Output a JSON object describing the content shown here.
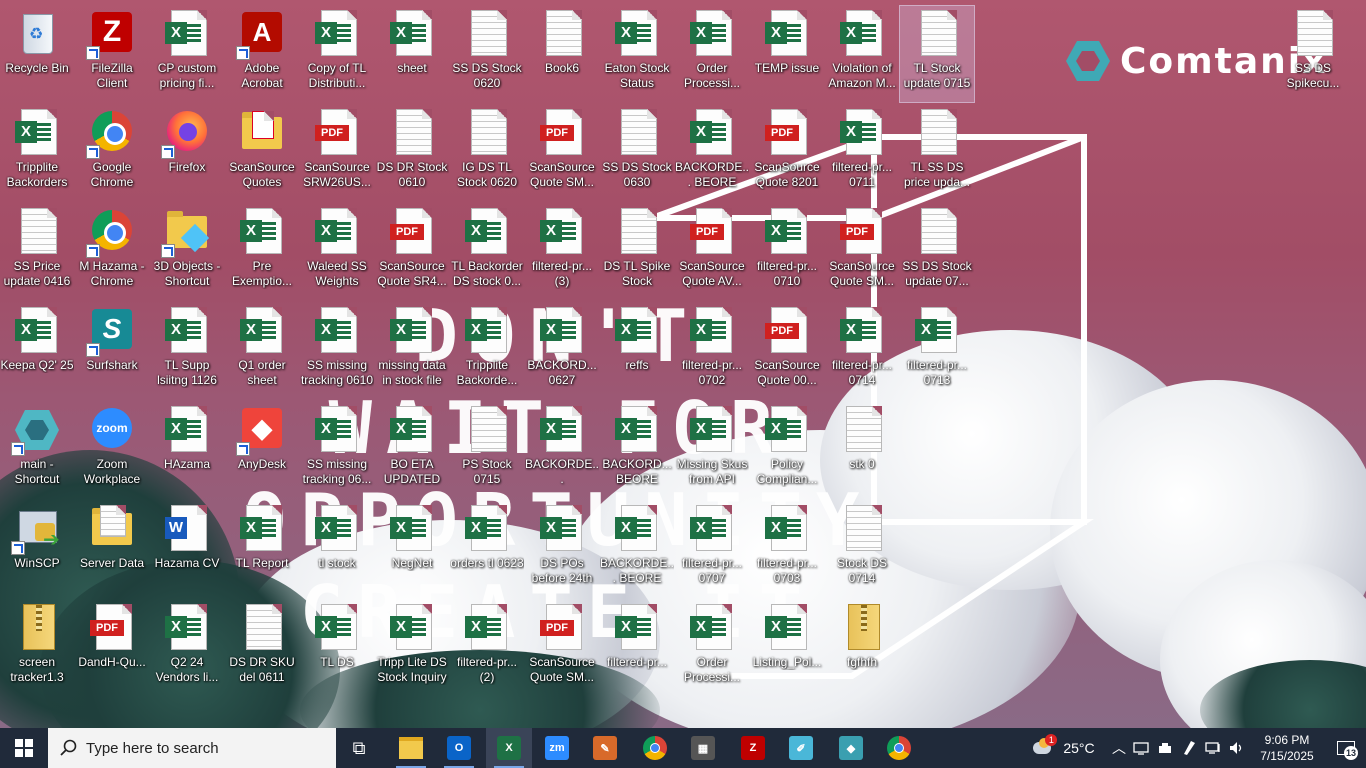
{
  "brand": {
    "name": "Comtanix"
  },
  "motto": {
    "lines": [
      "DON'T",
      "WAIT FOR",
      "OPPORTUNITY",
      "CREATE IT"
    ]
  },
  "desktop_icons": [
    {
      "label": "Recycle Bin",
      "kind": "recycle",
      "col": 0,
      "row": 0
    },
    {
      "label": "FileZilla Client",
      "kind": "filezilla",
      "col": 1,
      "row": 0,
      "shortcut": true
    },
    {
      "label": "CP custom pricing fi...",
      "kind": "excel",
      "col": 2,
      "row": 0
    },
    {
      "label": "Adobe Acrobat",
      "kind": "acrobat",
      "col": 3,
      "row": 0,
      "shortcut": true
    },
    {
      "label": "Copy of TL Distributi...",
      "kind": "excel",
      "col": 4,
      "row": 0
    },
    {
      "label": "sheet",
      "kind": "excel",
      "col": 5,
      "row": 0
    },
    {
      "label": "SS DS Stock 0620",
      "kind": "text",
      "col": 6,
      "row": 0
    },
    {
      "label": "Book6",
      "kind": "text",
      "col": 7,
      "row": 0
    },
    {
      "label": "Eaton Stock Status",
      "kind": "excel",
      "col": 8,
      "row": 0
    },
    {
      "label": "Order Processi...",
      "kind": "excel",
      "col": 9,
      "row": 0
    },
    {
      "label": "TEMP issue",
      "kind": "excel",
      "col": 10,
      "row": 0
    },
    {
      "label": "Violation of Amazon M...",
      "kind": "excel",
      "col": 11,
      "row": 0
    },
    {
      "label": "TL Stock update 0715",
      "kind": "text",
      "col": 12,
      "row": 0,
      "selected": true
    },
    {
      "label": "Tripplite Backorders",
      "kind": "excel",
      "col": 0,
      "row": 1
    },
    {
      "label": "Google Chrome",
      "kind": "chrome",
      "col": 1,
      "row": 1,
      "shortcut": true
    },
    {
      "label": "Firefox",
      "kind": "firefox",
      "col": 2,
      "row": 1,
      "shortcut": true
    },
    {
      "label": "ScanSource Quotes",
      "kind": "folder",
      "col": 3,
      "row": 1
    },
    {
      "label": "ScanSource SRW26US...",
      "kind": "pdf",
      "col": 4,
      "row": 1
    },
    {
      "label": "DS DR Stock 0610",
      "kind": "text",
      "col": 5,
      "row": 1
    },
    {
      "label": "IG DS TL Stock 0620",
      "kind": "text",
      "col": 6,
      "row": 1
    },
    {
      "label": "ScanSource Quote SM...",
      "kind": "pdf",
      "col": 7,
      "row": 1
    },
    {
      "label": "SS DS Stock 0630",
      "kind": "text",
      "col": 8,
      "row": 1
    },
    {
      "label": "BACKORDE... BEORE 23R...",
      "kind": "excel",
      "col": 9,
      "row": 1
    },
    {
      "label": "ScanSource Quote 8201",
      "kind": "pdf",
      "col": 10,
      "row": 1
    },
    {
      "label": "filtered-pr... 0711",
      "kind": "excel",
      "col": 11,
      "row": 1
    },
    {
      "label": "TL SS DS price upda...",
      "kind": "text",
      "col": 12,
      "row": 1
    },
    {
      "label": "SS Price update 0416",
      "kind": "text",
      "col": 0,
      "row": 2
    },
    {
      "label": "M Hazama - Chrome",
      "kind": "chrome",
      "col": 1,
      "row": 2,
      "shortcut": true
    },
    {
      "label": "3D Objects - Shortcut",
      "kind": "folder3d",
      "col": 2,
      "row": 2,
      "shortcut": true
    },
    {
      "label": "Pre Exemptio...",
      "kind": "excel",
      "col": 3,
      "row": 2
    },
    {
      "label": "Waleed SS Weights",
      "kind": "excel",
      "col": 4,
      "row": 2
    },
    {
      "label": "ScanSource Quote SR4...",
      "kind": "pdf",
      "col": 5,
      "row": 2
    },
    {
      "label": "TL Backorder DS stock 0...",
      "kind": "excel",
      "col": 6,
      "row": 2
    },
    {
      "label": "filtered-pr... (3)",
      "kind": "excel",
      "col": 7,
      "row": 2
    },
    {
      "label": "DS TL Spike Stock",
      "kind": "text",
      "col": 8,
      "row": 2
    },
    {
      "label": "ScanSource Quote AV...",
      "kind": "pdf",
      "col": 9,
      "row": 2
    },
    {
      "label": "filtered-pr... 0710",
      "kind": "excel",
      "col": 10,
      "row": 2
    },
    {
      "label": "ScanSource Quote SM...",
      "kind": "pdf",
      "col": 11,
      "row": 2
    },
    {
      "label": "SS DS Stock update 07...",
      "kind": "text",
      "col": 12,
      "row": 2
    },
    {
      "label": "Keepa Q2' 25",
      "kind": "excel",
      "col": 0,
      "row": 3
    },
    {
      "label": "Surfshark",
      "kind": "surfshark",
      "col": 1,
      "row": 3,
      "shortcut": true
    },
    {
      "label": "TL Supp lsiitng 1126",
      "kind": "excel",
      "col": 2,
      "row": 3
    },
    {
      "label": "Q1 order sheet",
      "kind": "excel",
      "col": 3,
      "row": 3
    },
    {
      "label": "SS missing tracking 0610",
      "kind": "excel",
      "col": 4,
      "row": 3
    },
    {
      "label": "missing data in stock file",
      "kind": "excel",
      "col": 5,
      "row": 3
    },
    {
      "label": "Tripplite Backorde...",
      "kind": "excel",
      "col": 6,
      "row": 3
    },
    {
      "label": "BACKORD... 0627",
      "kind": "excel",
      "col": 7,
      "row": 3
    },
    {
      "label": "reffs",
      "kind": "excel",
      "col": 8,
      "row": 3
    },
    {
      "label": "filtered-pr... 0702",
      "kind": "excel",
      "col": 9,
      "row": 3
    },
    {
      "label": "ScanSource Quote 00...",
      "kind": "pdf",
      "col": 10,
      "row": 3
    },
    {
      "label": "filtered-pr... 0714",
      "kind": "excel",
      "col": 11,
      "row": 3
    },
    {
      "label": "filtered-pr... 0713",
      "kind": "excel",
      "col": 12,
      "row": 3
    },
    {
      "label": "main - Shortcut",
      "kind": "comtanix",
      "col": 0,
      "row": 4,
      "shortcut": true
    },
    {
      "label": "Zoom Workplace",
      "kind": "zoom",
      "col": 1,
      "row": 4
    },
    {
      "label": "HAzama",
      "kind": "excel",
      "col": 2,
      "row": 4
    },
    {
      "label": "AnyDesk",
      "kind": "anydesk",
      "col": 3,
      "row": 4,
      "shortcut": true
    },
    {
      "label": "SS missing tracking 06...",
      "kind": "excel",
      "col": 4,
      "row": 4
    },
    {
      "label": "BO ETA UPDATED",
      "kind": "excel",
      "col": 5,
      "row": 4
    },
    {
      "label": "PS Stock 0715",
      "kind": "text",
      "col": 6,
      "row": 4
    },
    {
      "label": "BACKORDE... 0627(20250...",
      "kind": "excel",
      "col": 7,
      "row": 4
    },
    {
      "label": "BACKORD... BEORE 23R...",
      "kind": "excel",
      "col": 8,
      "row": 4
    },
    {
      "label": "Missing Skus from API",
      "kind": "excel",
      "col": 9,
      "row": 4
    },
    {
      "label": "Policy Complian...",
      "kind": "excel",
      "col": 10,
      "row": 4
    },
    {
      "label": "stk 0",
      "kind": "text",
      "col": 11,
      "row": 4
    },
    {
      "label": "WinSCP",
      "kind": "winscp",
      "col": 0,
      "row": 5,
      "shortcut": true
    },
    {
      "label": "Server Data",
      "kind": "folderdocs",
      "col": 1,
      "row": 5
    },
    {
      "label": "Hazama CV",
      "kind": "word",
      "col": 2,
      "row": 5
    },
    {
      "label": "TL Report",
      "kind": "excel",
      "col": 3,
      "row": 5
    },
    {
      "label": "tl stock",
      "kind": "excel",
      "col": 4,
      "row": 5
    },
    {
      "label": "NegNet",
      "kind": "excel",
      "col": 5,
      "row": 5
    },
    {
      "label": "orders tl 0623",
      "kind": "excel",
      "col": 6,
      "row": 5
    },
    {
      "label": "DS POs before 24th",
      "kind": "excel",
      "col": 7,
      "row": 5
    },
    {
      "label": "BACKORDE... BEORE 23R...",
      "kind": "excel",
      "col": 8,
      "row": 5
    },
    {
      "label": "filtered-pr... 0707",
      "kind": "excel",
      "col": 9,
      "row": 5
    },
    {
      "label": "filtered-pr... 0703",
      "kind": "excel",
      "col": 10,
      "row": 5
    },
    {
      "label": "Stock DS 0714",
      "kind": "text",
      "col": 11,
      "row": 5
    },
    {
      "label": "screen tracker1.3",
      "kind": "zip",
      "col": 0,
      "row": 6
    },
    {
      "label": "DandH-Qu...",
      "kind": "pdf",
      "col": 1,
      "row": 6
    },
    {
      "label": "Q2 24 Vendors li...",
      "kind": "excel",
      "col": 2,
      "row": 6
    },
    {
      "label": "DS DR SKU del 0611",
      "kind": "text",
      "col": 3,
      "row": 6
    },
    {
      "label": "TL DS",
      "kind": "excel",
      "col": 4,
      "row": 6
    },
    {
      "label": "Tripp Lite DS Stock Inquiry",
      "kind": "excel",
      "col": 5,
      "row": 6
    },
    {
      "label": "filtered-pr... (2)",
      "kind": "excel",
      "col": 6,
      "row": 6
    },
    {
      "label": "ScanSource Quote SM...",
      "kind": "pdf",
      "col": 7,
      "row": 6
    },
    {
      "label": "filtered-pr...",
      "kind": "excel",
      "col": 8,
      "row": 6
    },
    {
      "label": "Order Processi...",
      "kind": "excel",
      "col": 9,
      "row": 6
    },
    {
      "label": "Listing_Pol...",
      "kind": "excel",
      "col": 10,
      "row": 6
    },
    {
      "label": "fgfhfh",
      "kind": "zip",
      "col": 11,
      "row": 6
    }
  ],
  "right_icon": {
    "label": "SS DS Spikecu...",
    "kind": "text"
  },
  "taskbar": {
    "search_placeholder": "Type here to search",
    "apps": [
      {
        "name": "task-view",
        "glyph": "⧉"
      },
      {
        "name": "file-explorer",
        "glyph": ""
      },
      {
        "name": "outlook",
        "glyph": "O",
        "color": "#0a64c8"
      },
      {
        "name": "excel",
        "glyph": "X",
        "color": "#1e7145"
      },
      {
        "name": "zoom",
        "glyph": "zm",
        "color": "#2d8cff"
      },
      {
        "name": "paint",
        "glyph": "✎",
        "color": "#d86a2a"
      },
      {
        "name": "chrome-profile",
        "glyph": "",
        "color": "#db4437"
      },
      {
        "name": "calculator",
        "glyph": "▦",
        "color": "#555"
      },
      {
        "name": "filezilla",
        "glyph": "Z",
        "color": "#bf0000"
      },
      {
        "name": "notes",
        "glyph": "✐",
        "color": "#4ab7d8"
      },
      {
        "name": "comtanix",
        "glyph": "◆",
        "color": "#3a9fb0"
      },
      {
        "name": "chrome",
        "glyph": "",
        "color": "#db4437"
      }
    ],
    "weather": "25°C",
    "weather_badge": "1",
    "time": "9:06 PM",
    "date": "7/15/2025",
    "notifications": "13"
  }
}
